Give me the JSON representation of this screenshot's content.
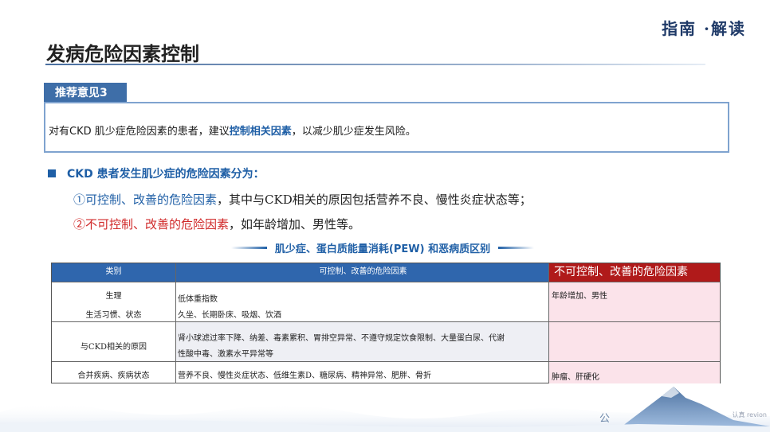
{
  "header": {
    "brand": "指南 ·解读",
    "title": "发病危险因素控制"
  },
  "recommendation": {
    "tag": "推荐意见3",
    "text_before": "对有CKD 肌少症危险因素的患者，建议",
    "text_highlight": "控制相关因素",
    "text_after": "，以减少肌少症发生风险。"
  },
  "risk_factors": {
    "heading": "CKD  患者发生肌少症的危险因素分为：",
    "item1_key": "①可控制、改善的危险因素",
    "item1_rest": "，其中与CKD相关的原因包括营养不良、慢性炎症状态等；",
    "item2_key": "②不可控制、改善的危险因素",
    "item2_rest": "，如年龄增加、男性等。"
  },
  "table_heading": "肌少症、蛋白质能量消耗(PEW)  和恶病质区别",
  "table": {
    "headers": [
      "类别",
      "可控制、改善的危险因素",
      "不可控制、改善的危险因素"
    ],
    "rows": [
      {
        "cat_lines": [
          "生理",
          "生活习惯、状态"
        ],
        "ctrl_lines": [
          "低体重指数",
          "久坐、长期卧床、吸烟、饮酒"
        ],
        "unctrl": "年龄增加、男性"
      },
      {
        "cat_lines": [
          "与CKD相关的原因"
        ],
        "ctrl_lines": [
          "肾小球滤过率下降、纳差、毒素累积、胃排空异常、不遵守规定饮食限制、大量蛋白尿、代谢",
          "性酸中毒、激素水平异常等"
        ],
        "unctrl": ""
      },
      {
        "cat_lines": [
          "合并疾病、疾病状态"
        ],
        "ctrl_lines": [
          "营养不良、慢性炎症状态、低维生素D、糖尿病、精神异常、肥胖、骨折"
        ],
        "unctrl": "肿瘤、肝硬化"
      }
    ]
  },
  "footer": {
    "page_char": "公",
    "watermark": "认真 revion"
  },
  "colors": {
    "primary_blue": "#1f5fa6",
    "accent_red": "#d02828",
    "header_red": "#b01a1a",
    "pink_cell": "#fbe3ea"
  }
}
